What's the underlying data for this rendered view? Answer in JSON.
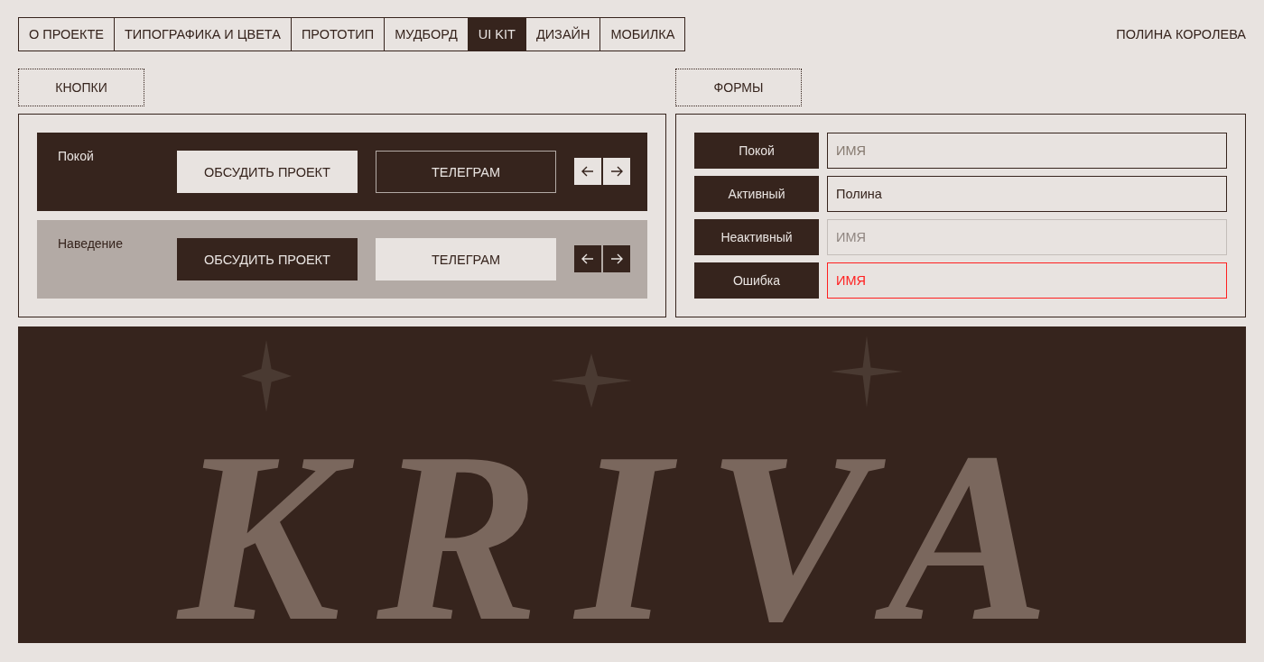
{
  "nav": {
    "tabs": [
      {
        "label": "О ПРОЕКТЕ",
        "selected": false
      },
      {
        "label": "ТИПОГРАФИКА И ЦВЕТА",
        "selected": false
      },
      {
        "label": "ПРОТОТИП",
        "selected": false
      },
      {
        "label": "МУДБОРД",
        "selected": false
      },
      {
        "label": "UI KIT",
        "selected": true
      },
      {
        "label": "ДИЗАЙН",
        "selected": false
      },
      {
        "label": "МОБИЛКА",
        "selected": false
      }
    ],
    "author": "ПОЛИНА КОРОЛЕВА"
  },
  "buttons_section": {
    "title": "КНОПКИ",
    "rows": [
      {
        "kind": "idle",
        "label": "Покой",
        "primary": "ОБСУДИТЬ ПРОЕКТ",
        "secondary": "ТЕЛЕГРАМ"
      },
      {
        "kind": "hover",
        "label": "Наведение",
        "primary": "ОБСУДИТЬ ПРОЕКТ",
        "secondary": "ТЕЛЕГРАМ"
      }
    ]
  },
  "forms_section": {
    "title": "ФОРМЫ",
    "rows": [
      {
        "kind": "idle",
        "label": "Покой",
        "placeholder": "ИМЯ"
      },
      {
        "kind": "active",
        "label": "Активный",
        "value": "Полина"
      },
      {
        "kind": "disabled",
        "label": "Неактивный",
        "placeholder": "ИМЯ"
      },
      {
        "kind": "error",
        "label": "Ошибка",
        "placeholder": "ИМЯ"
      }
    ]
  },
  "banner": {
    "text": "KRIVA"
  }
}
